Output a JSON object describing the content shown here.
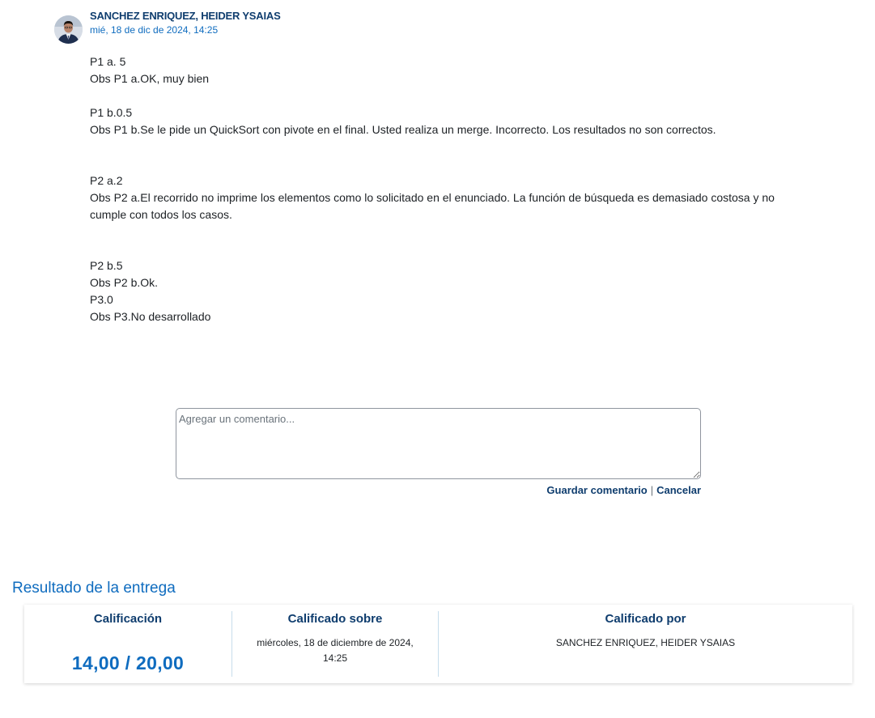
{
  "comment": {
    "author": "SANCHEZ ENRIQUEZ, HEIDER YSAIAS",
    "date": "mié, 18 de dic de 2024, 14:25",
    "lines": [
      "P1 a. 5",
      "Obs P1 a.OK, muy bien",
      "",
      "P1 b.0.5",
      "Obs P1 b.Se le pide un QuickSort con pivote en el final. Usted realiza un merge. Incorrecto. Los resultados no son correctos.",
      "",
      "",
      "P2 a.2",
      "Obs P2 a.El recorrido no imprime los elementos como lo solicitado en el enunciado. La función de búsqueda es demasiado costosa y no cumple con todos los casos.",
      "",
      "",
      "P2 b.5",
      "Obs P2 b.Ok.",
      "P3.0",
      "Obs P3.No desarrollado"
    ]
  },
  "add_comment": {
    "placeholder": "Agregar un comentario...",
    "save_label": "Guardar comentario",
    "separator": "|",
    "cancel_label": "Cancelar"
  },
  "result": {
    "title": "Resultado de la entrega",
    "grade_header": "Calificación",
    "grade_value": "14,00 / 20,00",
    "graded_on_header": "Calificado sobre",
    "graded_on_value": "miércoles, 18 de diciembre de 2024, 14:25",
    "graded_by_header": "Calificado por",
    "graded_by_value": "SANCHEZ ENRIQUEZ, HEIDER YSAIAS"
  },
  "colors": {
    "link_dark": "#0f3d6e",
    "link_blue": "#0f6cbf",
    "divider": "#c7ddec"
  },
  "icons": [
    "user-avatar"
  ]
}
